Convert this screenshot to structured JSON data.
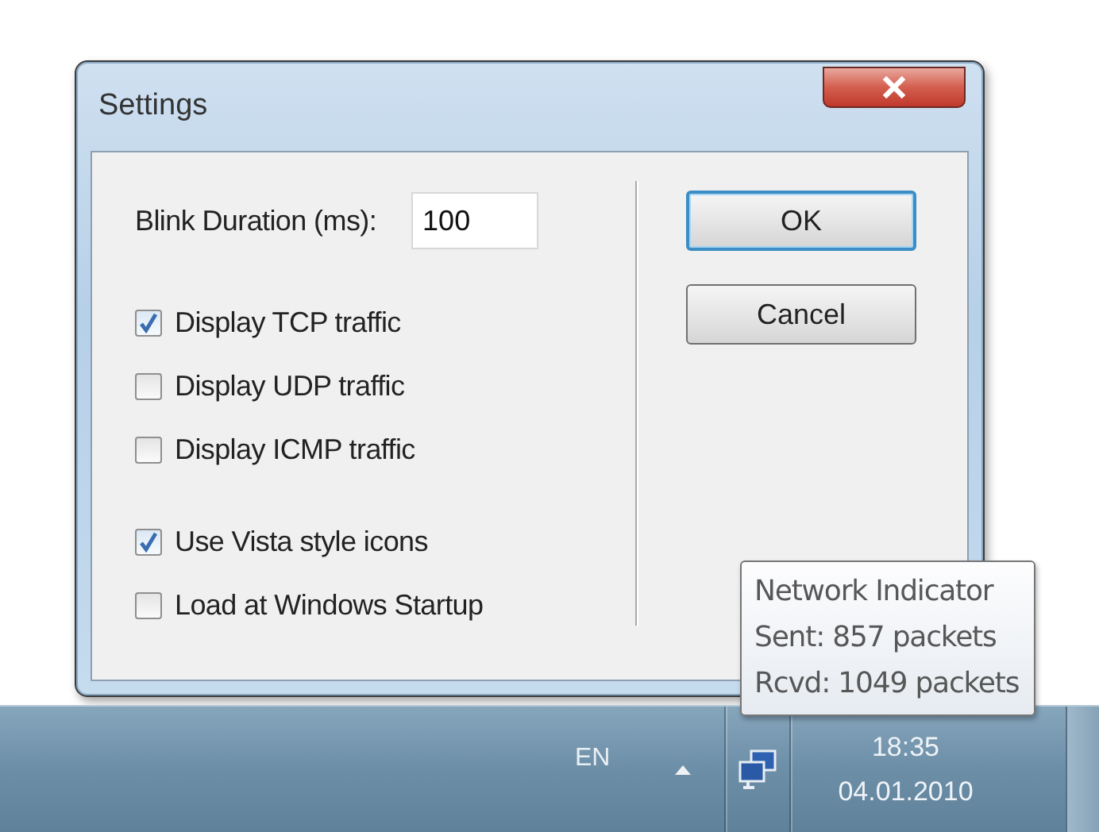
{
  "window": {
    "title": "Settings"
  },
  "blink_duration": {
    "label": "Blink Duration (ms):",
    "value": "100"
  },
  "checkbox_groups": [
    {
      "options": [
        {
          "label": "Display TCP traffic",
          "checked": true
        },
        {
          "label": "Display UDP traffic",
          "checked": false
        },
        {
          "label": "Display ICMP traffic",
          "checked": false
        }
      ]
    },
    {
      "options": [
        {
          "label": "Use Vista style icons",
          "checked": true
        },
        {
          "label": "Load at Windows Startup",
          "checked": false
        }
      ]
    }
  ],
  "buttons": [
    {
      "label": "OK",
      "default": true
    },
    {
      "label": "Cancel",
      "default": false
    }
  ],
  "tooltip": {
    "lines": [
      "Network Indicator",
      "Sent: 857 packets",
      "Rcvd: 1049 packets"
    ]
  },
  "taskbar": {
    "language": "EN",
    "time": "18:35",
    "date": "04.01.2010"
  }
}
